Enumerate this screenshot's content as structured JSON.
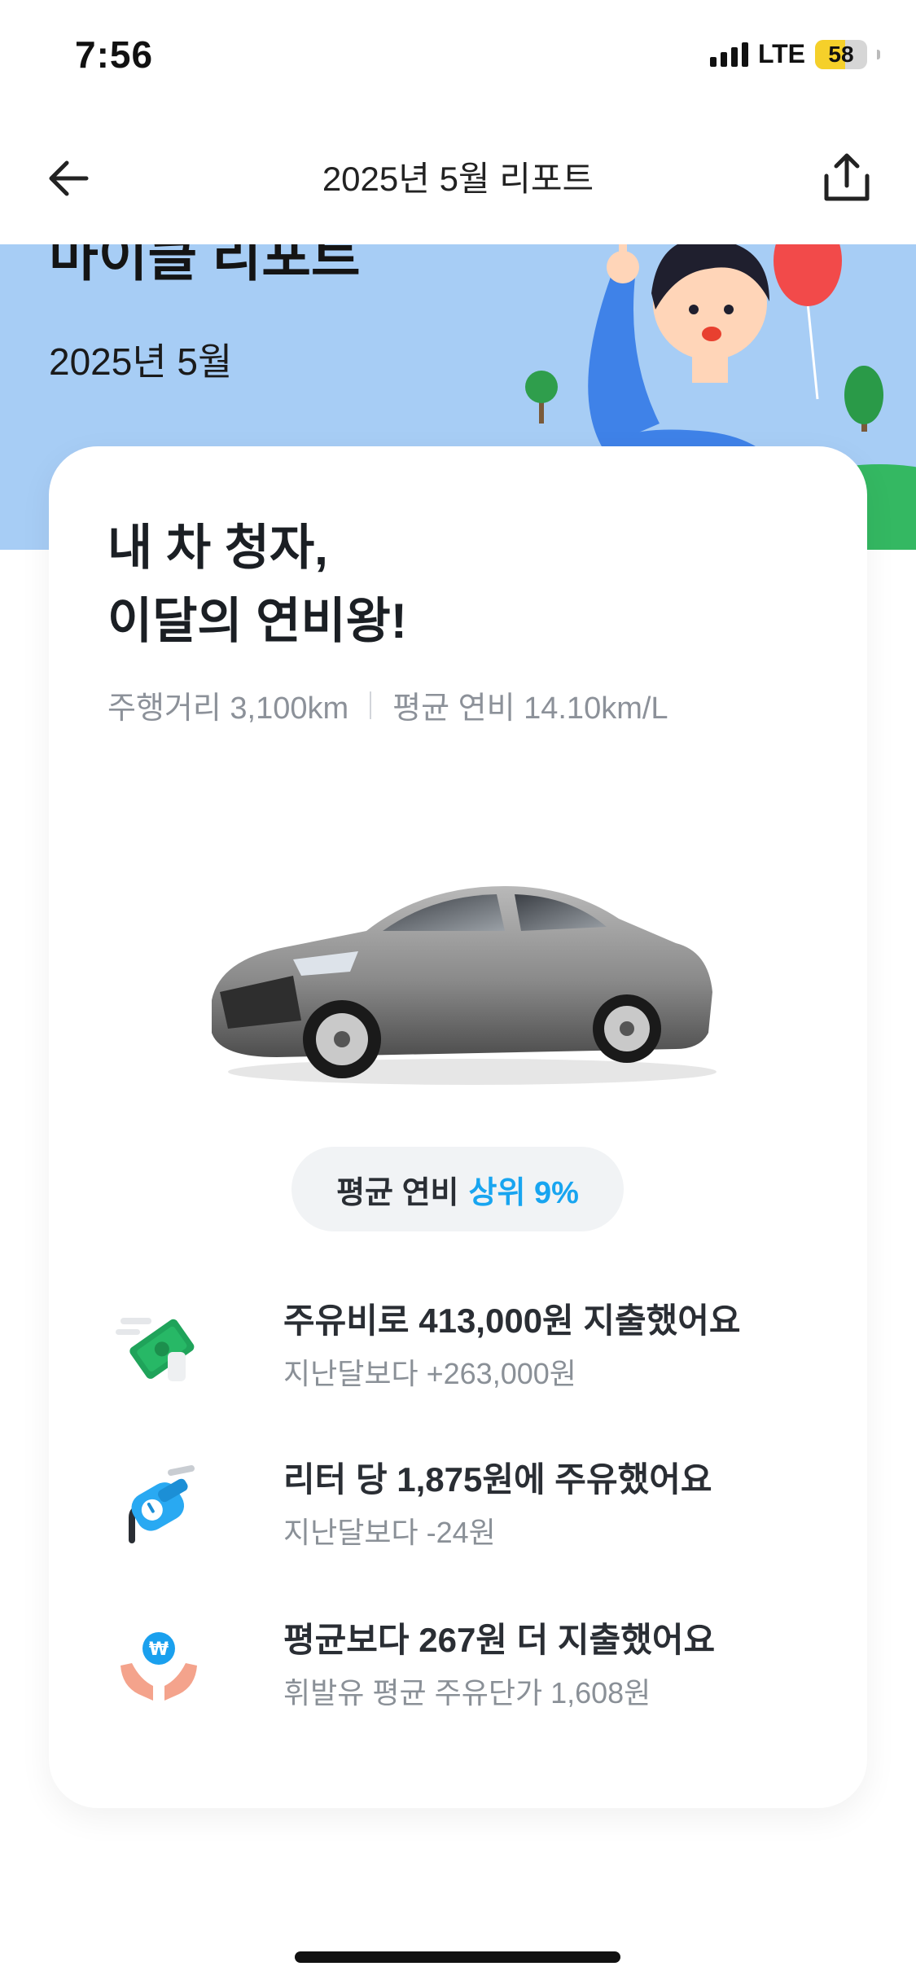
{
  "status_bar": {
    "time": "7:56",
    "network": "LTE",
    "battery": "58",
    "battery_level_percent": 58
  },
  "nav": {
    "title": "2025년 5월 리포트",
    "back_icon": "arrow-left-icon",
    "share_icon": "share-icon"
  },
  "hero": {
    "title": "마이클 리포트",
    "subtitle": "2025년 5월",
    "background_color": "#a7cdf5"
  },
  "card": {
    "headline_line1": "내 차 청자,",
    "headline_line2": "이달의 연비왕!",
    "distance": "주행거리 3,100km",
    "avg_fuel_economy": "평균 연비 14.10km/L",
    "pill_label": "평균 연비",
    "pill_accent": "상위 9%",
    "accent_color": "#18a5f0"
  },
  "items": [
    {
      "icon": "money-icon",
      "title": "주유비로 413,000원 지출했어요",
      "sub": "지난달보다 +263,000원"
    },
    {
      "icon": "fuel-nozzle-icon",
      "title": "리터 당 1,875원에 주유했어요",
      "sub": "지난달보다 -24원"
    },
    {
      "icon": "hands-won-icon",
      "title": "평균보다 267원 더 지출했어요",
      "sub": "휘발유 평균 주유단가 1,608원"
    }
  ]
}
